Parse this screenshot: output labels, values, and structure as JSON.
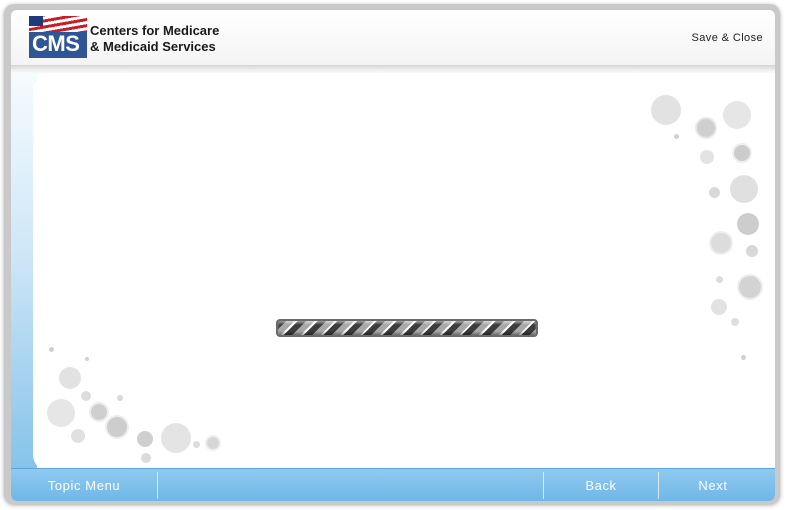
{
  "header": {
    "logo_text": "CMS",
    "org_name_line1": "Centers for Medicare",
    "org_name_line2": "& Medicaid Services",
    "save_close_label": "Save & Close"
  },
  "main": {
    "loading_indicator": "progress-bar-striped"
  },
  "footer": {
    "topic_menu_label": "Topic Menu",
    "back_label": "Back",
    "next_label": "Next"
  },
  "colors": {
    "footer_bg": "#7fbfea",
    "left_strip": "#86c3ea",
    "logo_blue": "#2f5597",
    "frame": "#c9c9c9"
  }
}
